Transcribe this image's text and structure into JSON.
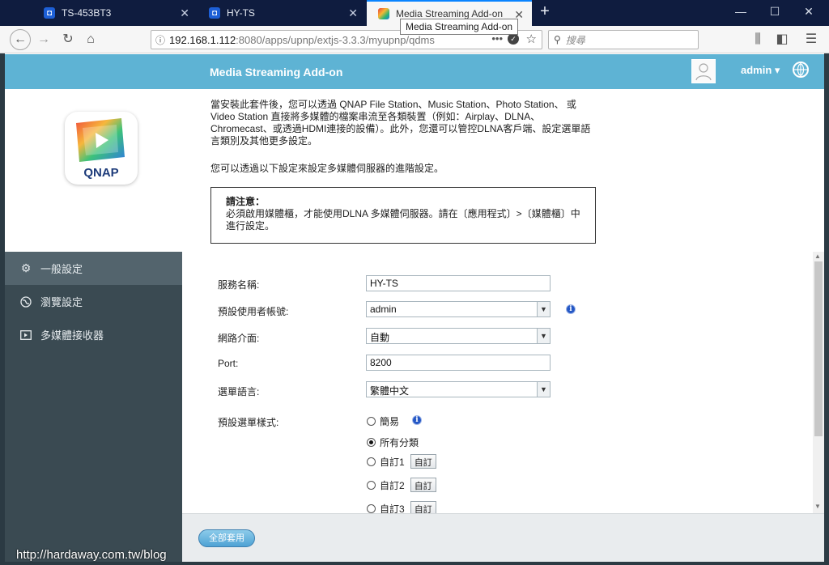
{
  "browser": {
    "tabs": [
      {
        "label": "TS-453BT3"
      },
      {
        "label": "HY-TS"
      },
      {
        "label": "Media Streaming Add-on"
      }
    ],
    "tooltip": "Media Streaming Add-on",
    "url_host": "192.168.1.112",
    "url_path": ":8080/apps/upnp/extjs-3.3.3/myupnp/qdms",
    "search_placeholder": "搜尋"
  },
  "header": {
    "title": "Media Streaming Add-on",
    "user": "admin ▾"
  },
  "intro": {
    "logo_text": "QNAP",
    "paragraph": "當安裝此套件後，您可以透過 QNAP File Station、Music Station、Photo Station、 或 Video Station 直接將多媒體的檔案串流至各類裝置（例如：Airplay、DLNA、Chromecast、或透過HDMI連接的設備）。此外，您還可以管控DLNA客戶端、設定選單語言類別及其他更多設定。",
    "paragraph2": "您可以透過以下設定來設定多媒體伺服器的進階設定。",
    "notice_title": "請注意：",
    "notice_body": "必須啟用媒體櫃，才能使用DLNA 多媒體伺服器。請在〔應用程式〕>〔媒體櫃〕中進行設定。"
  },
  "sidebar": {
    "items": [
      {
        "label": "一般設定",
        "icon": "gear-icon"
      },
      {
        "label": "瀏覽設定",
        "icon": "globe-icon"
      },
      {
        "label": "多媒體接收器",
        "icon": "media-receiver-icon"
      }
    ]
  },
  "form": {
    "service_name_label": "服務名稱:",
    "service_name_value": "HY-TS",
    "default_user_label": "預設使用者帳號:",
    "default_user_value": "admin",
    "network_label": "網路介面:",
    "network_value": "自動",
    "port_label": "Port:",
    "port_value": "8200",
    "menu_lang_label": "選單語言:",
    "menu_lang_value": "繁體中文",
    "menu_style_label": "預設選單樣式:",
    "menu_styles": [
      {
        "label": "簡易",
        "checked": false
      },
      {
        "label": "所有分類",
        "checked": true
      },
      {
        "label": "自訂1",
        "checked": false,
        "button": "自訂"
      },
      {
        "label": "自訂2",
        "checked": false,
        "button": "自訂"
      },
      {
        "label": "自訂3",
        "checked": false,
        "button": "自訂"
      }
    ]
  },
  "footer": {
    "apply_all": "全部套用"
  },
  "watermark": "http://hardaway.com.tw/blog"
}
